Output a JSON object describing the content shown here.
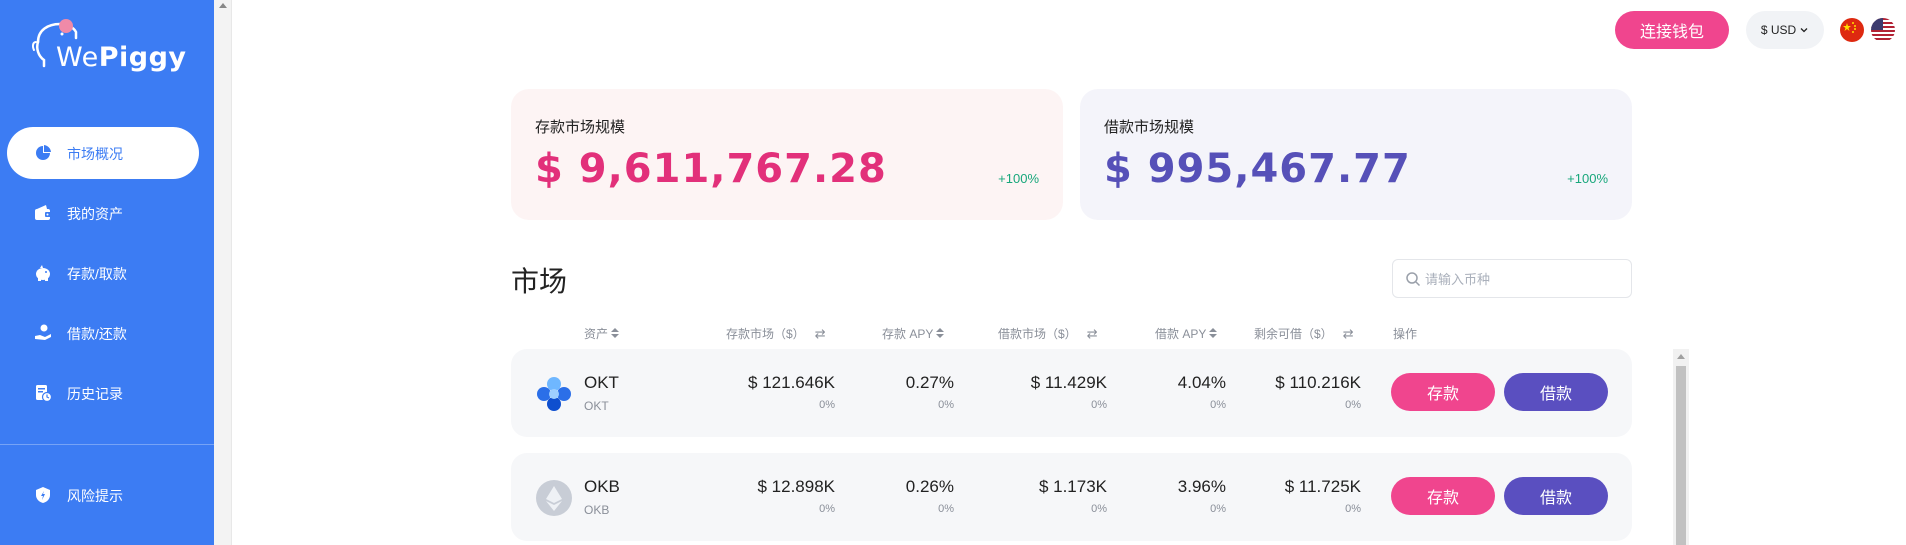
{
  "brand": {
    "prefix": "We",
    "suffix": "Piggy"
  },
  "sidebar": {
    "items": [
      {
        "label": "市场概况",
        "icon": "pie-chart-icon",
        "active": true
      },
      {
        "label": "我的资产",
        "icon": "wallet-icon",
        "active": false
      },
      {
        "label": "存款/取款",
        "icon": "piggy-bank-icon",
        "active": false
      },
      {
        "label": "借款/还款",
        "icon": "hand-coin-icon",
        "active": false
      },
      {
        "label": "历史记录",
        "icon": "history-icon",
        "active": false
      }
    ],
    "risk_label": "风险提示"
  },
  "header": {
    "connect_label": "连接钱包",
    "currency_label": "$ USD"
  },
  "summary": {
    "deposit": {
      "title": "存款市场规模",
      "value": "$ 9,611,767.28",
      "change": "+100%"
    },
    "borrow": {
      "title": "借款市场规模",
      "value": "$ 995,467.77",
      "change": "+100%"
    }
  },
  "market": {
    "title": "市场",
    "search_placeholder": "请输入币种",
    "columns": {
      "asset": "资产",
      "deposit_market": "存款市场（$）",
      "deposit_apy": "存款 APY",
      "borrow_market": "借款市场（$）",
      "borrow_apy": "借款 APY",
      "remaining": "剩余可借（$）",
      "action": "操作"
    },
    "rows": [
      {
        "name": "OKT",
        "symbol": "OKT",
        "deposit_market": "$ 121.646K",
        "deposit_market_change": "0%",
        "deposit_apy": "0.27%",
        "deposit_apy_change": "0%",
        "borrow_market": "$ 11.429K",
        "borrow_market_change": "0%",
        "borrow_apy": "4.04%",
        "borrow_apy_change": "0%",
        "remaining": "$ 110.216K",
        "remaining_change": "0%",
        "deposit_btn": "存款",
        "borrow_btn": "借款"
      },
      {
        "name": "OKB",
        "symbol": "OKB",
        "deposit_market": "$ 12.898K",
        "deposit_market_change": "0%",
        "deposit_apy": "0.26%",
        "deposit_apy_change": "0%",
        "borrow_market": "$ 1.173K",
        "borrow_market_change": "0%",
        "borrow_apy": "3.96%",
        "borrow_apy_change": "0%",
        "remaining": "$ 11.725K",
        "remaining_change": "0%",
        "deposit_btn": "存款",
        "borrow_btn": "借款"
      }
    ]
  },
  "colors": {
    "sidebar": "#3c7cf3",
    "deposit_accent": "#e2307a",
    "borrow_accent": "#5650b8",
    "positive": "#18a77b",
    "deposit_button": "#f0458e",
    "borrow_button": "#5a4fc0"
  }
}
